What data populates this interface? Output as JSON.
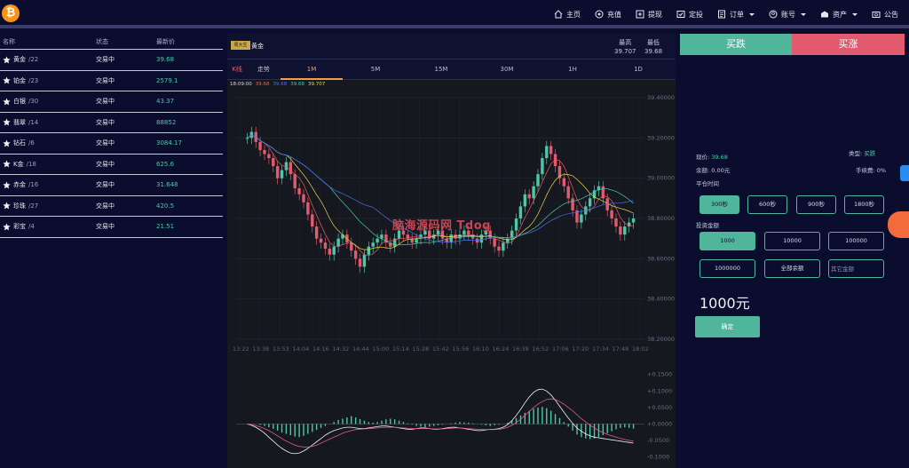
{
  "nav": {
    "items": [
      {
        "label": "主页",
        "icon": "home-icon",
        "caret": false
      },
      {
        "label": "充值",
        "icon": "recharge-icon",
        "caret": false
      },
      {
        "label": "提现",
        "icon": "withdraw-icon",
        "caret": false
      },
      {
        "label": "定投",
        "icon": "invest-icon",
        "caret": false
      },
      {
        "label": "订单",
        "icon": "order-icon",
        "caret": true
      },
      {
        "label": "账号",
        "icon": "user-icon",
        "caret": true
      },
      {
        "label": "资产",
        "icon": "asset-icon",
        "caret": true
      },
      {
        "label": "公告",
        "icon": "notice-icon",
        "caret": false
      }
    ]
  },
  "list": {
    "headers": {
      "name": "名称",
      "state": "状态",
      "price": "最新价"
    },
    "rows": [
      {
        "name": "黄金",
        "sub": "/22",
        "state": "交易中",
        "price": "39.68"
      },
      {
        "name": "铂金",
        "sub": "/23",
        "state": "交易中",
        "price": "2579.1"
      },
      {
        "name": "白银",
        "sub": "/30",
        "state": "交易中",
        "price": "43.37"
      },
      {
        "name": "翡翠",
        "sub": "/14",
        "state": "交易中",
        "price": "88852"
      },
      {
        "name": "钻石",
        "sub": "/6",
        "state": "交易中",
        "price": "3084.17"
      },
      {
        "name": "K金",
        "sub": "/18",
        "state": "交易中",
        "price": "625.6"
      },
      {
        "name": "赤金",
        "sub": "/16",
        "state": "交易中",
        "price": "31.648"
      },
      {
        "name": "珍珠",
        "sub": "/27",
        "state": "交易中",
        "price": "420.5"
      },
      {
        "name": "彩宝",
        "sub": "/4",
        "state": "交易中",
        "price": "21.51"
      }
    ]
  },
  "center": {
    "brand_logo_text": "周大生",
    "product": "黄金",
    "high_label": "最高",
    "high_value": "39.707",
    "low_label": "最低",
    "low_value": "39.68",
    "tabs": [
      "K线",
      "走势",
      "1M",
      "5M",
      "15M",
      "30M",
      "1H",
      "1D"
    ],
    "active_tab": "1M",
    "legend": {
      "time": "18:09:00",
      "v1": "39.68",
      "v2": "39.68",
      "v3": "39.68",
      "v4": "39.707"
    },
    "watermark": "脑海源码网 Tdog"
  },
  "colors": {
    "accent": "#4fb69c",
    "danger": "#e15a6e",
    "price": "#4fc6a7",
    "active_tab": "#f29b4a"
  },
  "chart_data": {
    "type": "candlestick",
    "ylim": [
      38.2,
      39.4
    ],
    "yticks": [
      "39.40000",
      "39.20000",
      "39.00000",
      "38.80000",
      "38.60000",
      "38.40000",
      "38.20000"
    ],
    "xticks": [
      "13:22",
      "13:38",
      "13:53",
      "14:04",
      "14:16",
      "14:32",
      "14:44",
      "15:00",
      "15:14",
      "15:28",
      "15:42",
      "15:56",
      "16:10",
      "16:24",
      "16:38",
      "16:52",
      "17:06",
      "17:20",
      "17:34",
      "17:48",
      "18:02"
    ],
    "close": [
      39.2,
      39.23,
      39.18,
      39.14,
      39.12,
      39.1,
      39.06,
      39.0,
      39.04,
      39.08,
      39.02,
      38.95,
      38.92,
      38.88,
      38.82,
      38.76,
      38.7,
      38.68,
      38.65,
      38.62,
      38.66,
      38.7,
      38.72,
      38.68,
      38.64,
      38.6,
      38.56,
      38.62,
      38.66,
      38.68,
      38.7,
      38.72,
      38.68,
      38.66,
      38.7,
      38.74,
      38.72,
      38.7,
      38.68,
      38.7,
      38.72,
      38.74,
      38.7,
      38.72,
      38.74,
      38.7,
      38.68,
      38.72,
      38.7,
      38.72,
      38.74,
      38.72,
      38.7,
      38.68,
      38.72,
      38.74,
      38.7,
      38.66,
      38.64,
      38.68,
      38.7,
      38.74,
      38.8,
      38.86,
      38.92,
      38.9,
      38.96,
      39.02,
      39.1,
      39.16,
      39.12,
      39.06,
      39.0,
      38.96,
      38.9,
      38.84,
      38.78,
      38.82,
      38.86,
      38.9,
      38.94,
      38.96,
      38.9,
      38.84,
      38.8,
      38.76,
      38.72,
      38.76,
      38.78,
      38.8
    ],
    "macd_ticks": [
      "+0.1500",
      "+0.1000",
      "+0.0500",
      "+0.0000",
      "-0.0500",
      "-0.1000"
    ],
    "macd_ylim": [
      -0.12,
      0.16
    ],
    "macd_hist": [
      0.0,
      0.0,
      0.0,
      -0.003,
      -0.006,
      -0.01,
      -0.015,
      -0.02,
      -0.026,
      -0.03,
      -0.034,
      -0.038,
      -0.04,
      -0.036,
      -0.03,
      -0.024,
      -0.018,
      -0.012,
      -0.006,
      0.0,
      0.006,
      0.012,
      0.016,
      0.02,
      0.024,
      0.02,
      0.015,
      0.01,
      0.006,
      0.004,
      0.006,
      0.01,
      0.014,
      0.016,
      0.014,
      0.01,
      0.006,
      0.002,
      -0.002,
      -0.006,
      -0.008,
      -0.01,
      -0.008,
      -0.006,
      -0.004,
      -0.002,
      0.0,
      0.002,
      0.004,
      0.006,
      0.005,
      0.004,
      0.002,
      0.0,
      -0.002,
      -0.004,
      -0.006,
      -0.004,
      -0.002,
      0.0,
      0.004,
      0.01,
      0.018,
      0.026,
      0.034,
      0.04,
      0.046,
      0.05,
      0.052,
      0.048,
      0.04,
      0.03,
      0.018,
      0.006,
      -0.008,
      -0.02,
      -0.032,
      -0.04,
      -0.044,
      -0.046,
      -0.044,
      -0.04,
      -0.034,
      -0.028,
      -0.022,
      -0.016,
      -0.012,
      -0.01,
      -0.012,
      -0.014
    ],
    "macd_dif": [
      0.0,
      -0.004,
      -0.01,
      -0.018,
      -0.028,
      -0.04,
      -0.052,
      -0.064,
      -0.074,
      -0.082,
      -0.088,
      -0.09,
      -0.088,
      -0.082,
      -0.074,
      -0.064,
      -0.054,
      -0.044,
      -0.034,
      -0.026,
      -0.02,
      -0.016,
      -0.012,
      -0.01,
      -0.01,
      -0.012,
      -0.014,
      -0.014,
      -0.012,
      -0.01,
      -0.008,
      -0.006,
      -0.006,
      -0.008,
      -0.01,
      -0.012,
      -0.014,
      -0.016,
      -0.016,
      -0.014,
      -0.012,
      -0.012,
      -0.014,
      -0.016,
      -0.016,
      -0.014,
      -0.012,
      -0.01,
      -0.01,
      -0.012,
      -0.014,
      -0.016,
      -0.018,
      -0.02,
      -0.02,
      -0.018,
      -0.016,
      -0.016,
      -0.014,
      -0.01,
      -0.002,
      0.01,
      0.026,
      0.044,
      0.064,
      0.082,
      0.096,
      0.104,
      0.106,
      0.1,
      0.088,
      0.072,
      0.054,
      0.036,
      0.018,
      0.002,
      -0.012,
      -0.022,
      -0.03,
      -0.036,
      -0.04,
      -0.042,
      -0.044,
      -0.046,
      -0.048,
      -0.05,
      -0.052,
      -0.054,
      -0.056,
      -0.058
    ],
    "macd_dea": [
      0.0,
      -0.002,
      -0.005,
      -0.009,
      -0.014,
      -0.02,
      -0.028,
      -0.036,
      -0.044,
      -0.052,
      -0.058,
      -0.064,
      -0.068,
      -0.07,
      -0.07,
      -0.068,
      -0.064,
      -0.058,
      -0.052,
      -0.046,
      -0.04,
      -0.034,
      -0.028,
      -0.024,
      -0.02,
      -0.017,
      -0.016,
      -0.015,
      -0.014,
      -0.013,
      -0.012,
      -0.011,
      -0.01,
      -0.01,
      -0.01,
      -0.011,
      -0.012,
      -0.013,
      -0.014,
      -0.014,
      -0.014,
      -0.014,
      -0.014,
      -0.015,
      -0.015,
      -0.015,
      -0.014,
      -0.013,
      -0.012,
      -0.012,
      -0.013,
      -0.014,
      -0.015,
      -0.016,
      -0.017,
      -0.017,
      -0.017,
      -0.017,
      -0.016,
      -0.014,
      -0.01,
      -0.004,
      0.004,
      0.014,
      0.026,
      0.038,
      0.05,
      0.06,
      0.068,
      0.074,
      0.076,
      0.074,
      0.068,
      0.06,
      0.05,
      0.04,
      0.028,
      0.016,
      0.006,
      -0.004,
      -0.012,
      -0.02,
      -0.026,
      -0.032,
      -0.036,
      -0.04,
      -0.044,
      -0.047,
      -0.05,
      -0.052
    ]
  },
  "panel": {
    "fall_label": "买跌",
    "rise_label": "买涨",
    "price_label": "现价:",
    "price_value": "39.68",
    "type_label": "类型:",
    "type_value": "买跌",
    "balance_label": "余额:",
    "balance_value": "0.00元",
    "fee_label": "手续费:",
    "fee_value": "0%",
    "time_title": "平仓时间",
    "times": [
      "300秒",
      "600秒",
      "900秒",
      "1800秒"
    ],
    "amount_title": "投资金额",
    "amounts": [
      "1000",
      "10000",
      "100000",
      "1000000",
      "全部余额"
    ],
    "custom_placeholder": "其它金额",
    "amount_display": "1000元",
    "confirm_label": "确定"
  }
}
